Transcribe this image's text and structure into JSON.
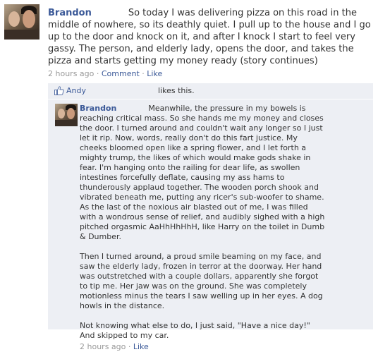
{
  "post": {
    "author": "Brandon",
    "text": "So today I was delivering pizza on this road in the middle of nowhere, so its deathly quiet. I pull up to the house and I go up to the door and knock on it, and after I knock I start to feel very gassy. The person, and elderly lady, opens the door, and takes the pizza and starts getting my money ready (story continues)",
    "time": "2 hours ago",
    "sep1": "·",
    "comment_link": "Comment",
    "sep2": "·",
    "like_link": "Like"
  },
  "likes": {
    "name": "Andy",
    "text": "likes this."
  },
  "comment": {
    "author": "Brandon",
    "paragraphs": [
      "Meanwhile, the pressure in my bowels is reaching critical mass. So she hands me my money and closes the door. I turned around and couldn't wait any longer so I just let it rip. Now, words, really don't do this fart justice. My cheeks bloomed open like a spring flower, and I let forth a mighty trump, the likes of which would make gods shake in fear. I'm hanging onto the railing for dear life, as swollen intestines forcefully deflate, causing my ass hams to thunderously applaud together. The wooden porch shook and vibrated beneath me, putting any ricer's sub-woofer to shame. As the last of the noxious air blasted out of me, I was filled with a wondrous sense of relief, and audibly sighed with a high pitched orgasmic AaHhHhHhH, like Harry on the toilet in Dumb & Dumber.",
      "Then I turned around, a proud smile beaming on my face, and saw the elderly lady, frozen in terror at the doorway. Her hand was outstretched with a couple dollars, apparently she forgot to tip me. Her jaw was on the ground. She was completely motionless minus the tears I saw welling up in her eyes. A dog howls in the distance.",
      "Not knowing what else to do, I just said, \"Have a nice day!\" And skipped to my car."
    ],
    "time": "2 hours ago",
    "sep": "·",
    "like_link": "Like"
  }
}
